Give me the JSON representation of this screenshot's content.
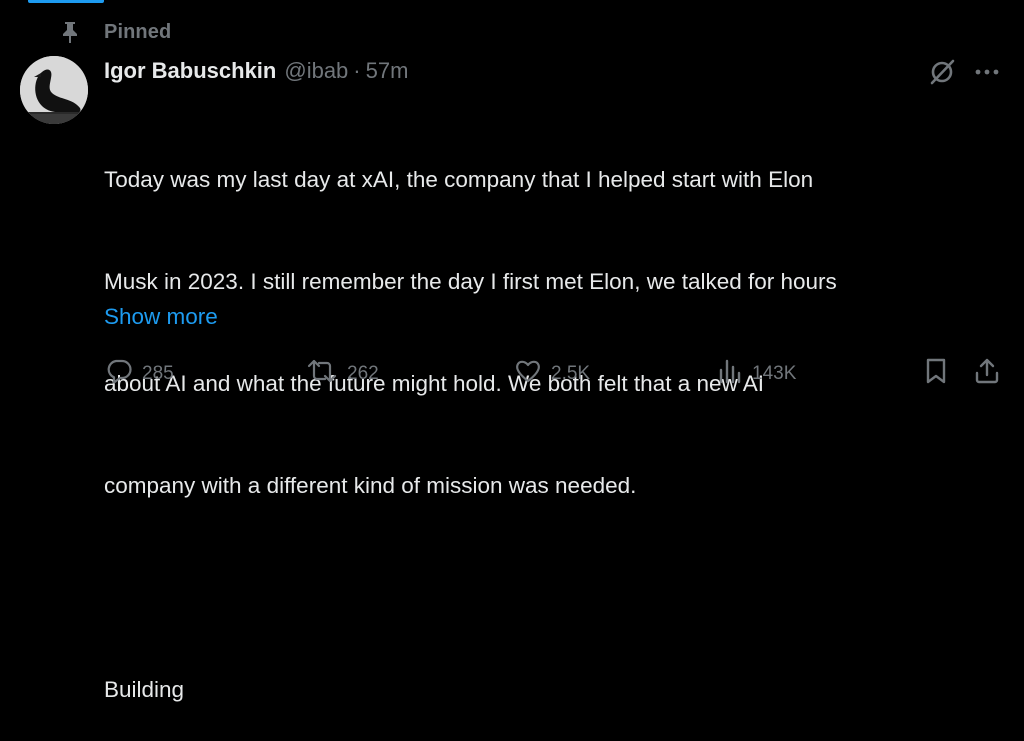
{
  "pinned": {
    "label": "Pinned",
    "icon": "pin-icon"
  },
  "author": {
    "display_name": "Igor Babuschkin",
    "handle": "@ibab",
    "separator": "·",
    "time": "57m",
    "avatar": "black-swan-avatar"
  },
  "tweet": {
    "lines": [
      "Today was my last day at xAI, the company that I helped start with Elon",
      "Musk in 2023. I still remember the day I first met Elon, we talked for hours",
      "about AI and what the future might hold. We both felt that a new AI",
      "company with a different kind of mission was needed.",
      "",
      "Building"
    ],
    "show_more": "Show more"
  },
  "actions": {
    "reply": {
      "icon": "reply-icon",
      "count": "285"
    },
    "repost": {
      "icon": "repost-icon",
      "count": "262"
    },
    "like": {
      "icon": "heart-icon",
      "count": "2.5K"
    },
    "views": {
      "icon": "views-icon",
      "count": "143K"
    },
    "bookmark": {
      "icon": "bookmark-icon"
    },
    "share": {
      "icon": "share-icon"
    }
  },
  "header_icons": {
    "grok": "grok-icon",
    "more": "more-icon"
  },
  "colors": {
    "background": "#000000",
    "text": "#e7e9ea",
    "secondary": "#71767b",
    "link": "#1d9bf0"
  }
}
